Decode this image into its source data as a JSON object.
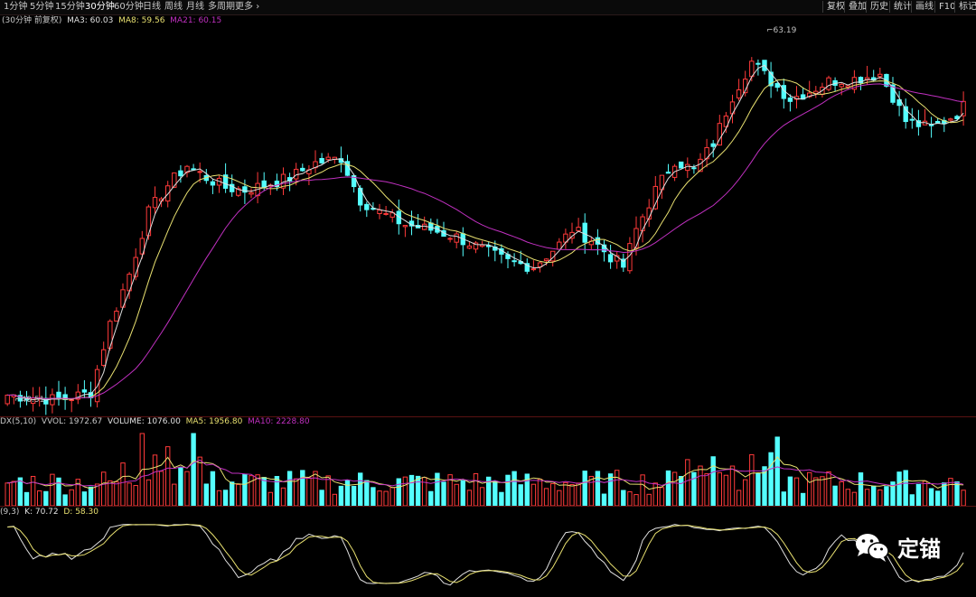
{
  "toolbar": {
    "timeframes": [
      "1分钟",
      "5分钟",
      "15分钟",
      "30分钟",
      "60分钟",
      "日线",
      "周线",
      "月线",
      "多周期",
      "更多"
    ],
    "active_index": 3,
    "right_buttons": [
      "复权",
      "叠加",
      "历史",
      "统计",
      "画线",
      "F10",
      "标记"
    ]
  },
  "main": {
    "period_label": "(30分钟 前复权)",
    "ma3_label": "MA3: 60.03",
    "ma8_label": "MA8: 59.56",
    "ma21_label": "MA21: 60.15",
    "high_label": "63.19",
    "low_label": "48.51",
    "colors": {
      "up": "#ff3a3a",
      "down": "#54ffff",
      "ma3": "#e0e0e0",
      "ma8": "#e8e070",
      "ma21": "#c030c0"
    }
  },
  "volume": {
    "indicator_label": "DX(5,10)",
    "vvol_label": "VVOL: 1972.67",
    "volume_label": "VOLUME: 1076.00",
    "ma5_label": "MA5: 1956.80",
    "ma10_label": "MA10: 2228.80"
  },
  "kdj": {
    "indicator_label": "(9,3)",
    "k_label": "K: 70.72",
    "d_label": "D: 58.30"
  },
  "watermark": {
    "text": "定锚"
  }
}
